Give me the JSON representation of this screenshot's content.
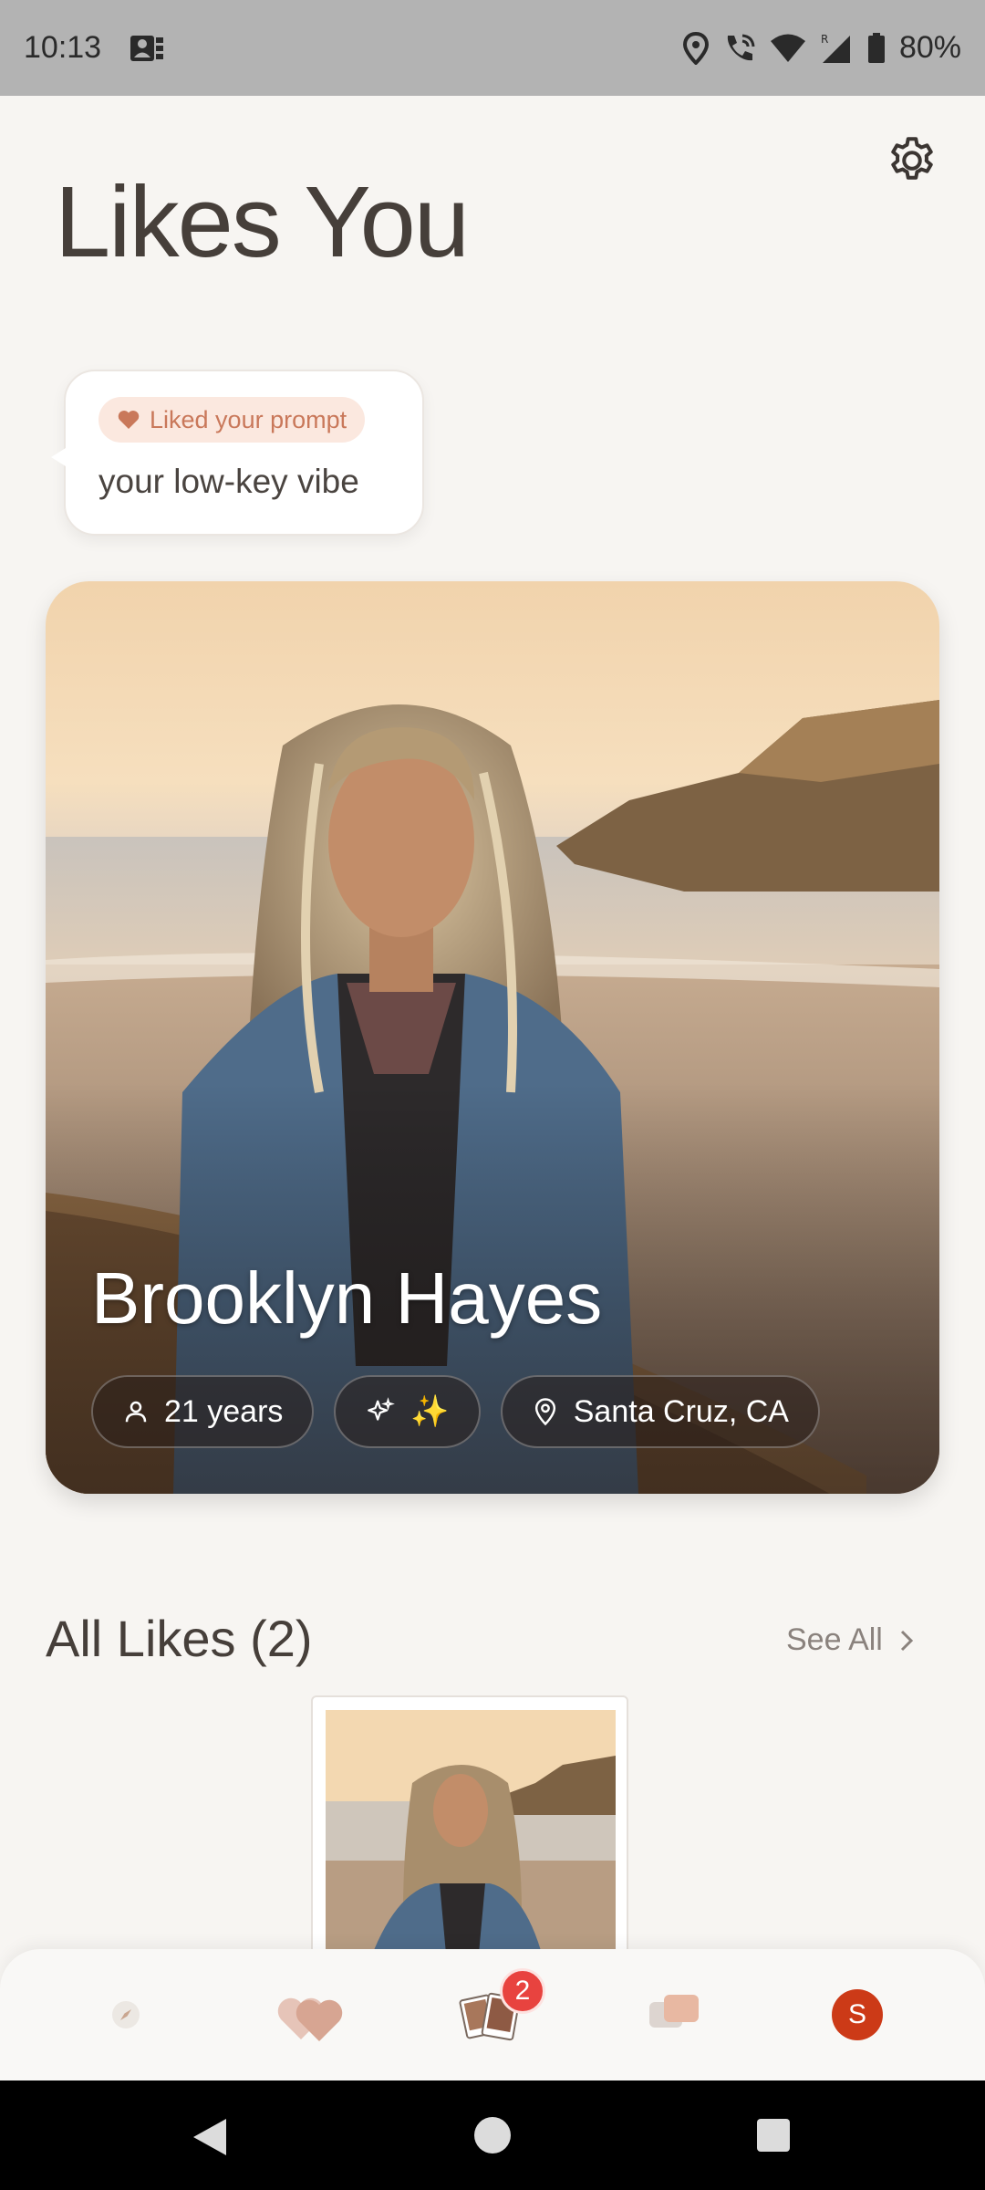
{
  "status_bar": {
    "time": "10:13",
    "battery": "80%",
    "icons": [
      "gallery-icon",
      "location-icon",
      "wifi-call-icon",
      "wifi-icon",
      "signal-icon",
      "battery-icon"
    ]
  },
  "header": {
    "title": "Likes You",
    "settings_icon": "gear-icon"
  },
  "prompt_bubble": {
    "chip_label": "Liked your prompt",
    "text": "your low-key vibe"
  },
  "profile": {
    "name": "Brooklyn Hayes",
    "age": "21 years",
    "sparkle": "✨",
    "location": "Santa Cruz, CA"
  },
  "all_likes": {
    "title": "All Likes (2)",
    "see_all": "See All"
  },
  "bottom_nav": {
    "items": [
      "compass-icon",
      "hearts-icon",
      "photos-icon",
      "chat-icon",
      "profile-avatar"
    ],
    "badge": "2",
    "avatar_letter": "S"
  },
  "colors": {
    "background": "#f7f5f2",
    "accent": "#c9785a",
    "badge": "#e8433f",
    "avatar": "#cc3a17"
  }
}
